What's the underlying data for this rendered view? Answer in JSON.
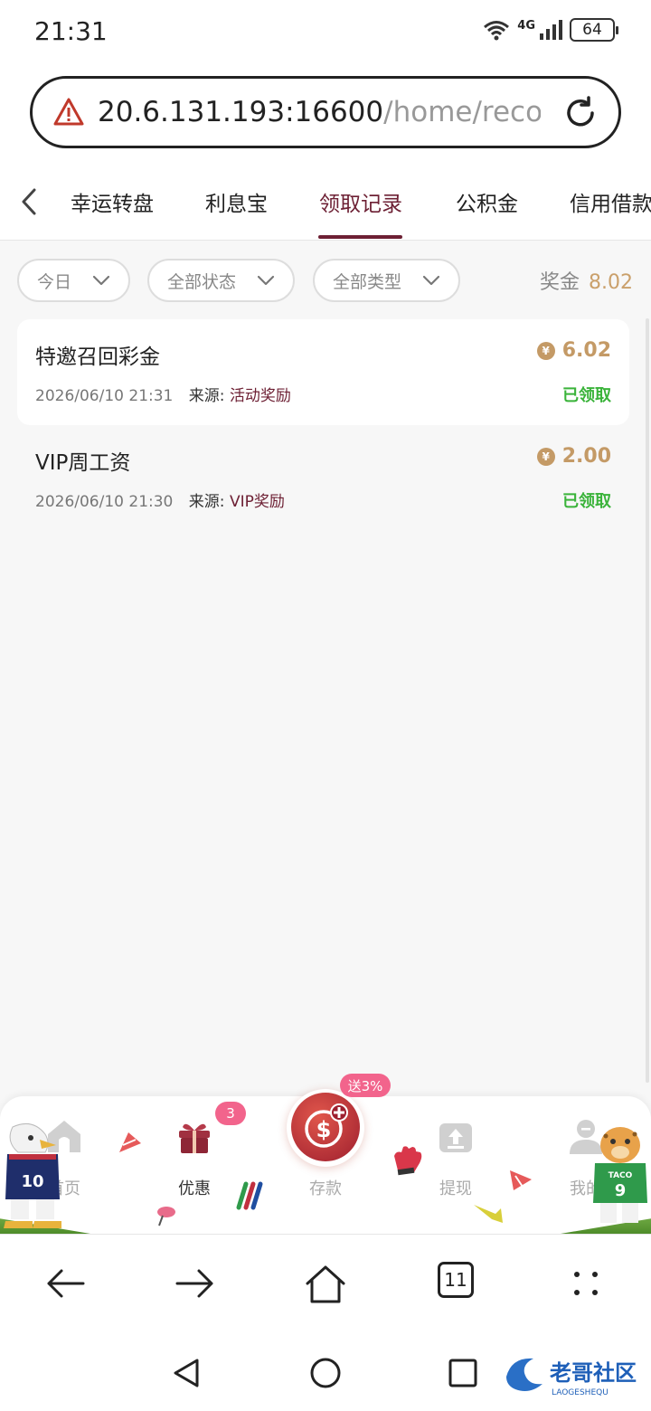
{
  "status_bar": {
    "time": "21:31",
    "network": "4G",
    "battery": "64"
  },
  "url_bar": {
    "host": "20.6.131.193:16600",
    "path": "/home/records"
  },
  "tabs": [
    {
      "label": "幸运转盘"
    },
    {
      "label": "利息宝"
    },
    {
      "label": "领取记录",
      "active": true
    },
    {
      "label": "公积金"
    },
    {
      "label": "信用借款"
    }
  ],
  "filters": {
    "date": "今日",
    "status": "全部状态",
    "type": "全部类型"
  },
  "bonus": {
    "label": "奖金",
    "value": "8.02"
  },
  "records": [
    {
      "title": "特邀召回彩金",
      "amount": "6.02",
      "time": "2026/06/10 21:31",
      "source_label": "来源:",
      "source": "活动奖励",
      "status": "已领取"
    },
    {
      "title": "VIP周工资",
      "amount": "2.00",
      "time": "2026/06/10 21:30",
      "source_label": "来源:",
      "source": "VIP奖励",
      "status": "已领取"
    }
  ],
  "app_nav": {
    "home": "首页",
    "promo": "优惠",
    "promo_badge": "3",
    "deposit": "存款",
    "deposit_tag": "送3%",
    "withdraw": "提现",
    "mine": "我的"
  },
  "browser_nav": {
    "tab_count": "11"
  },
  "colors": {
    "accent": "#6d2034",
    "gold": "#c49a66",
    "success": "#3ab33a",
    "badge": "#f2648c"
  },
  "watermark": {
    "text": "老哥社区",
    "sub": "LAOGESHEQU"
  }
}
